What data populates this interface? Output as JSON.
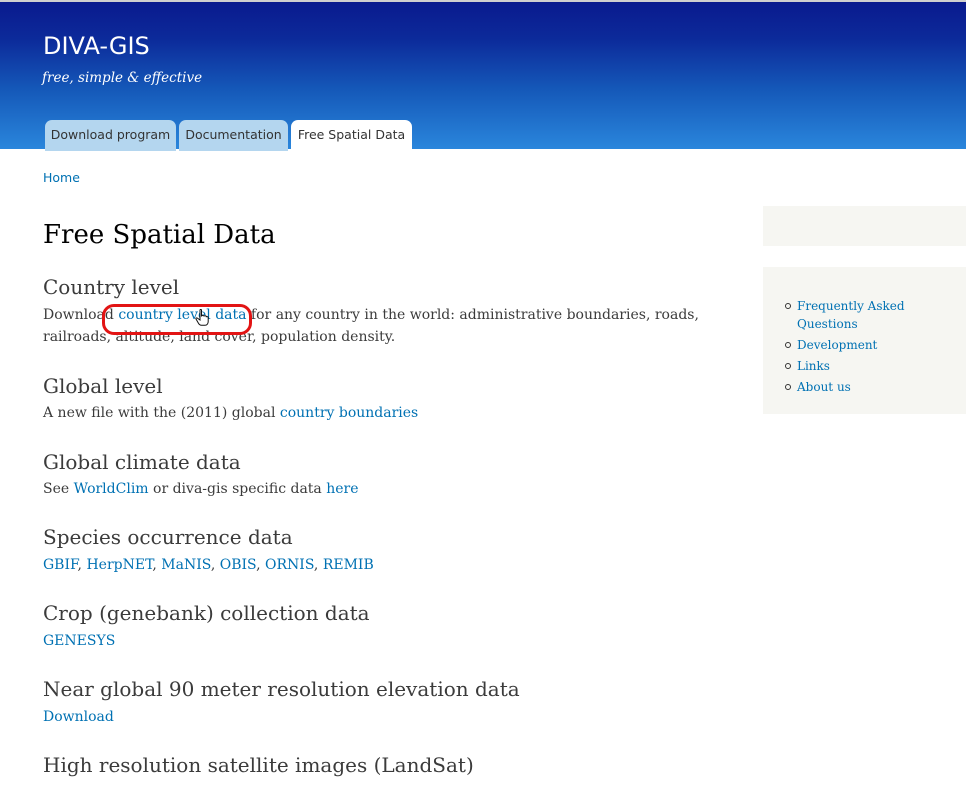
{
  "header": {
    "site_name": "DIVA-GIS",
    "slogan": "free, simple & effective"
  },
  "tabs": [
    {
      "label": "Download program",
      "active": false
    },
    {
      "label": "Documentation",
      "active": false
    },
    {
      "label": "Free Spatial Data",
      "active": true
    }
  ],
  "breadcrumb": {
    "home": "Home"
  },
  "page_title": "Free Spatial Data",
  "sections": {
    "country": {
      "title": "Country level",
      "prefix": "Download ",
      "link": "country level data",
      "suffix": " for any country in the world: administrative boundaries, roads, railroads, altitude, land cover, population density."
    },
    "global": {
      "title": "Global level",
      "prefix": "A new file with the (2011) global ",
      "link": "country boundaries"
    },
    "climate": {
      "title": "Global climate data",
      "prefix": "See ",
      "link1": "WorldClim",
      "middle": " or diva-gis specific data ",
      "link2": "here"
    },
    "species": {
      "title": "Species occurrence data",
      "links": [
        "GBIF",
        "HerpNET",
        "MaNIS",
        "OBIS",
        "ORNIS",
        "REMIB"
      ],
      "separator": ", "
    },
    "crop": {
      "title": "Crop (genebank) collection data",
      "link": "GENESYS"
    },
    "elevation": {
      "title": "Near global 90 meter resolution elevation data",
      "link": "Download"
    },
    "satellite": {
      "title": "High resolution satellite images (LandSat)"
    }
  },
  "sidebar": {
    "items": [
      {
        "label": "Frequently Asked Questions"
      },
      {
        "label": "Development"
      },
      {
        "label": "Links"
      },
      {
        "label": "About us"
      }
    ]
  },
  "colors": {
    "link": "#0071b3",
    "header_top": "#0a1a8e",
    "header_bottom": "#2a86dc",
    "tab_inactive": "#b4d6ef",
    "annotation": "#e21414"
  },
  "icons": {
    "cursor": "hand-pointer-cursor-icon"
  }
}
